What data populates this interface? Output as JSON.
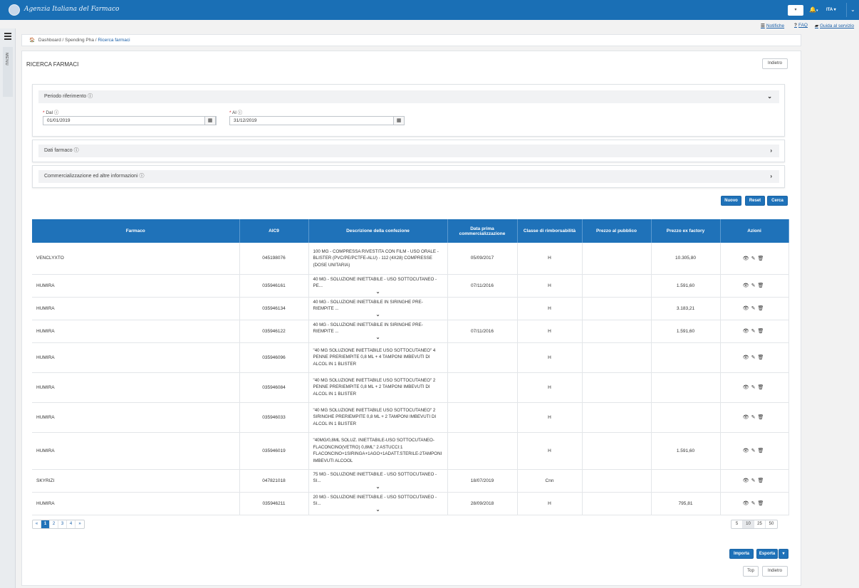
{
  "header": {
    "logo_text": "Agenzia Italiana del Farmaco",
    "lang": "ITA",
    "colors": {
      "brand": "#1a6fb5",
      "accent": "#1f72b9",
      "required": "#d2232a"
    }
  },
  "utility": {
    "notifiche": "Notifiche",
    "faq": "FAQ",
    "guida": "Guida al servizio"
  },
  "sidebar": {
    "menu_label": "MENU"
  },
  "breadcrumb": {
    "items": [
      "Dashboard",
      "Spending Pha",
      "Ricerca farmaci"
    ],
    "sep": " / "
  },
  "page": {
    "title": "RICERCA FARMACI",
    "back_label": "Indietro"
  },
  "sections": {
    "periodo": "Periodo riferimento ⓘ",
    "dati": "Dati farmaco ⓘ",
    "commercializzazione": "Commercializzazione ed altre informazioni ⓘ"
  },
  "fields": {
    "dal": {
      "label": "Dal ⓘ",
      "value": "01/01/2019"
    },
    "al": {
      "label": "Al ⓘ",
      "value": "31/12/2019"
    }
  },
  "actions_top": {
    "nuovo": "Nuovo",
    "reset": "Reset",
    "cerca": "Cerca"
  },
  "table": {
    "columns": [
      "Farmaco",
      "AIC9",
      "Descrizione della confezione",
      "Data prima commercializzazione",
      "Classe di rimborsabilità",
      "Prezzo al pubblico",
      "Prezzo ex factory",
      "Azioni"
    ],
    "rows": [
      {
        "farmaco": "VENCLYXTO",
        "aic9": "045198076",
        "desc": "100 MG - COMPRESSA RIVESTITA CON FILM - USO ORALE - BLISTER (PVC/PE/PCTFE-ALU) - 112 (4X28) COMPRESSE (DOSE UNITARIA)",
        "data": "05/09/2017",
        "classe": "H",
        "pubblico": "",
        "ex_factory": "10.305,80"
      },
      {
        "farmaco": "HUMIRA",
        "aic9": "035946161",
        "desc": "40 MG - SOLUZIONE INIETTABILE - USO SOTTOCUTANEO - PE...",
        "data": "07/11/2016",
        "classe": "H",
        "pubblico": "",
        "ex_factory": "1.591,60"
      },
      {
        "farmaco": "HUMIRA",
        "aic9": "035946134",
        "desc": "40 MG - SOLUZIONE INIETTABILE IN SIRINGHE PRE-RIEMPITE ...",
        "data": "",
        "classe": "H",
        "pubblico": "",
        "ex_factory": "3.183,21"
      },
      {
        "farmaco": "HUMIRA",
        "aic9": "035946122",
        "desc": "40 MG - SOLUZIONE INIETTABILE IN SIRINGHE PRE-RIEMPITE ...",
        "data": "07/11/2016",
        "classe": "H",
        "pubblico": "",
        "ex_factory": "1.591,60"
      },
      {
        "farmaco": "HUMIRA",
        "aic9": "035946096",
        "desc": "\"40 MG SOLUZIONE INIETTABILE USO SOTTOCUTANEO\" 4 PENNE PRERIEMPITE 0,8 ML + 4 TAMPONI IMBEVUTI DI ALCOL IN 1 BLISTER",
        "data": "",
        "classe": "H",
        "pubblico": "",
        "ex_factory": ""
      },
      {
        "farmaco": "HUMIRA",
        "aic9": "035946084",
        "desc": "\"40 MG SOLUZIONE INIETTABILE USO SOTTOCUTANEO\" 2 PENNE PRERIEMPITE 0,8 ML + 2 TAMPONI IMBEVUTI DI ALCOL IN 1 BLISTER",
        "data": "",
        "classe": "H",
        "pubblico": "",
        "ex_factory": ""
      },
      {
        "farmaco": "HUMIRA",
        "aic9": "035946033",
        "desc": "\"40 MG SOLUZIONE INIETTABILE USO SOTTOCUTANEO\" 2 SIRINGHE PRERIEMPITE 0,8 ML + 2 TAMPONI IMBEVUTI DI ALCOL IN 1 BLISTER",
        "data": "",
        "classe": "H",
        "pubblico": "",
        "ex_factory": ""
      },
      {
        "farmaco": "HUMIRA",
        "aic9": "035946019",
        "desc": "\"40MG/0,8ML SOLUZ. INIETTABILE-USO SOTTOCUTANEO-FLACONCINO(VETRO) 0,8ML\" 2 ASTUCCI:1 FLACONCINO+1SIRINGA+1AGO+1ADATT.STERILE-2TAMPONI IMBEVUTI ALCOOL",
        "data": "",
        "classe": "H",
        "pubblico": "",
        "ex_factory": "1.591,60"
      },
      {
        "farmaco": "SKYRIZI",
        "aic9": "047821018",
        "desc": "75 MG - SOLUZIONE INIETTABILE - USO SOTTOCUTANEO - SI...",
        "data": "18/07/2019",
        "classe": "Cnn",
        "pubblico": "",
        "ex_factory": ""
      },
      {
        "farmaco": "HUMIRA",
        "aic9": "035946211",
        "desc": "20 MG - SOLUZIONE INIETTABILE - USO SOTTOCUTANEO - SI...",
        "data": "28/09/2018",
        "classe": "H",
        "pubblico": "",
        "ex_factory": "795,81"
      }
    ]
  },
  "pagination": {
    "prev": "«",
    "pages": [
      "1",
      "2",
      "3",
      "4"
    ],
    "next": "»",
    "current": "1"
  },
  "page_size": {
    "options": [
      "5",
      "10",
      "25",
      "50"
    ],
    "selected": "10"
  },
  "actions_bottom": {
    "importa": "Importa",
    "esporta": "Esporta",
    "top": "Top",
    "indietro": "Indietro"
  }
}
